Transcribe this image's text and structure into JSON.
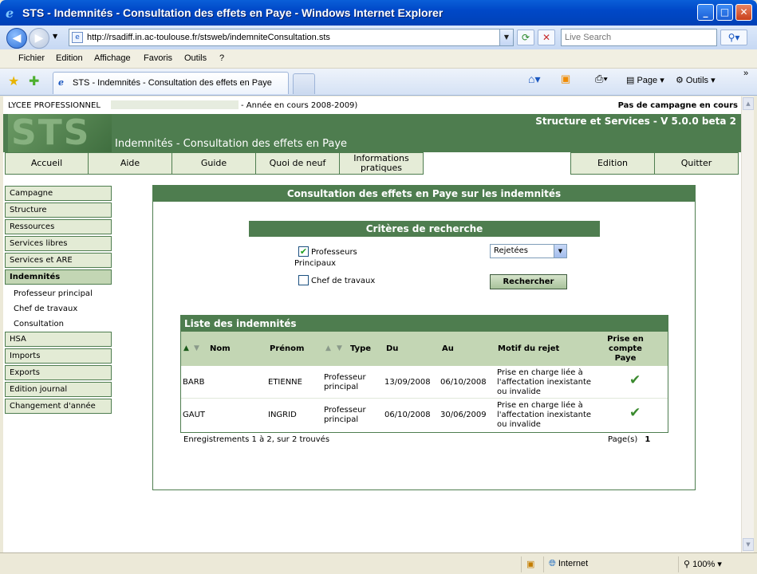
{
  "window": {
    "title": "STS - Indemnités - Consultation des effets en Paye - Windows Internet Explorer"
  },
  "browser": {
    "url": "http://rsadiff.in.ac-toulouse.fr/stsweb/indemniteConsultation.sts",
    "search_placeholder": "Live Search",
    "menu": [
      "Fichier",
      "Edition",
      "Affichage",
      "Favoris",
      "Outils",
      "?"
    ],
    "tab_title": "STS - Indemnités - Consultation des effets en Paye",
    "toolbar": {
      "page": "Page",
      "outils": "Outils"
    },
    "status": {
      "zone": "Internet",
      "zoom": "100%"
    }
  },
  "page": {
    "lycee": "LYCEE PROFESSIONNEL",
    "annee": "- Année en cours 2008-2009)",
    "campagne": "Pas de campagne en cours",
    "logo": "STS",
    "version": "Structure et Services - V 5.0.0 beta 2",
    "title": "Indemnités - Consultation des effets en Paye",
    "nav": [
      "Accueil",
      "Aide",
      "Guide",
      "Quoi de neuf",
      "Informations pratiques",
      "Edition",
      "Quitter"
    ],
    "sidebar": {
      "items": [
        "Campagne",
        "Structure",
        "Ressources",
        "Services libres",
        "Services et ARE",
        "Indemnités",
        "HSA",
        "Imports",
        "Exports",
        "Edition journal",
        "Changement d'année"
      ],
      "subitems": [
        "Professeur principal",
        "Chef de travaux",
        "Consultation"
      ]
    },
    "main": {
      "heading": "Consultation des effets en Paye sur les indemnités",
      "criteria_heading": "Critères de recherche",
      "checkbox_pp": "Professeurs Principaux",
      "checkbox_pp_line1": "Professeurs",
      "checkbox_pp_line2": "Principaux",
      "checkbox_pp_checked": true,
      "checkbox_ct": "Chef de travaux",
      "checkbox_ct_checked": false,
      "select_value": "Rejetées",
      "search_button": "Rechercher",
      "list_heading": "Liste des indemnités",
      "columns": [
        "Nom",
        "Prénom",
        "Type",
        "Du",
        "Au",
        "Motif du rejet",
        "Prise en compte Paye"
      ],
      "col_prise": [
        "Prise en",
        "compte",
        "Paye"
      ],
      "rows": [
        {
          "nom": "BARB",
          "prenom": "ETIENNE",
          "type": [
            "Professeur",
            "principal"
          ],
          "du": "13/09/2008",
          "au": "06/10/2008",
          "motif": [
            "Prise en charge liée à",
            "l'affectation inexistante",
            "ou invalide"
          ],
          "prise": true
        },
        {
          "nom": "GAUT",
          "prenom": "INGRID",
          "type": [
            "Professeur",
            "principal"
          ],
          "du": "06/10/2008",
          "au": "30/06/2009",
          "motif": [
            "Prise en charge liée à",
            "l'affectation inexistante",
            "ou invalide"
          ],
          "prise": true
        }
      ],
      "records": "Enregistrements 1 à 2, sur 2 trouvés",
      "pages_label": "Page(s)",
      "current_page": "1"
    }
  }
}
